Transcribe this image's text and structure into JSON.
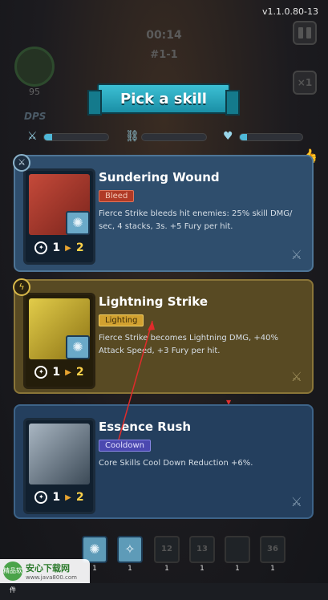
{
  "hud": {
    "version": "v1.1.0.80-13",
    "timer": "00:14",
    "stage": "#1-1",
    "avatar_value": "95",
    "dps_label": "DPS",
    "speed_label": "×1",
    "bars": [
      {
        "icon": "sword-icon",
        "fill": 0.12
      },
      {
        "icon": "chain-icon",
        "fill": 0.0
      },
      {
        "icon": "heart-icon",
        "fill": 0.12
      }
    ]
  },
  "banner": {
    "title": "Pick a skill"
  },
  "skills": [
    {
      "name": "Sundering Wound",
      "tag": "Bleed",
      "description": "Fierce Strike bleeds hit enemies: 25% skill DMG/ sec, 4 stacks, 3s. +5 Fury per hit.",
      "level_from": "1",
      "level_to": "2",
      "badge_icon": "sword-icon"
    },
    {
      "name": "Lightning Strike",
      "tag": "Lighting",
      "description": "Fierce Strike becomes Lightning DMG, +40% Attack Speed, +3 Fury per hit.",
      "level_from": "1",
      "level_to": "2",
      "badge_icon": "lightning-icon"
    },
    {
      "name": "Essence Rush",
      "tag": "Cooldown",
      "description": "Core Skills Cool Down Reduction +6%.",
      "level_from": "1",
      "level_to": "2",
      "badge_icon": ""
    }
  ],
  "skill_bar": {
    "slots": [
      {
        "label": "",
        "level": "1"
      },
      {
        "label": "",
        "level": "1"
      },
      {
        "label": "12",
        "level": "1"
      },
      {
        "label": "13",
        "level": "1"
      },
      {
        "label": "",
        "level": "1"
      },
      {
        "label": "36",
        "level": "1"
      }
    ]
  },
  "watermark": {
    "logo": "精品软件",
    "title": "安心下载网",
    "url": "www.java800.com"
  },
  "colors": {
    "blue_card": "#2f4e6d",
    "gold_card": "#584a23",
    "banner": "#3cc0d4",
    "level_accent": "#ffd24a"
  }
}
